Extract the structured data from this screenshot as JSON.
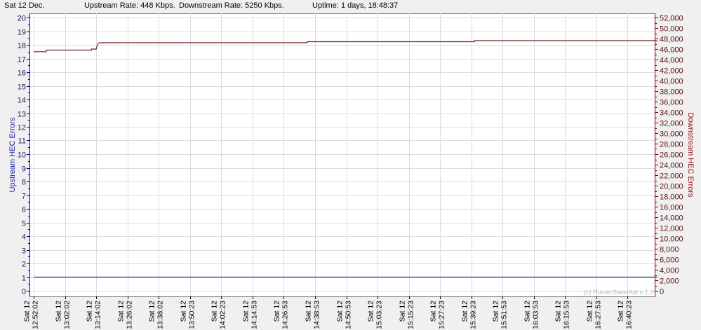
{
  "status": {
    "date": "Sat 12 Dec.",
    "upstream_rate": "Upstream Rate: 448 Kbps.",
    "downstream_rate": "Downstream Rate: 5250 Kbps.",
    "uptime": "Uptime: 1 days, 18:48:37"
  },
  "colors": {
    "upstream": "#1f3f8f",
    "downstream": "#7a1f1f"
  },
  "chart_data": {
    "type": "line",
    "title": "",
    "watermark": "(c) RouterStatsHub v 1.3",
    "ylabel": "Upstream HEC Errors",
    "y2label": "Downstream HEC Errors",
    "ylim": [
      0,
      20
    ],
    "y2lim": [
      0,
      52000
    ],
    "yticks": [
      "0",
      "1",
      "2",
      "3",
      "4",
      "5",
      "6",
      "7",
      "8",
      "9",
      "10",
      "11",
      "12",
      "13",
      "14",
      "15",
      "16",
      "17",
      "18",
      "19",
      "20"
    ],
    "y2ticks": [
      "0",
      "2,000",
      "4,000",
      "6,000",
      "8,000",
      "10,000",
      "12,000",
      "14,000",
      "16,000",
      "18,000",
      "20,000",
      "22,000",
      "24,000",
      "26,000",
      "28,000",
      "30,000",
      "32,000",
      "34,000",
      "36,000",
      "38,000",
      "40,000",
      "42,000",
      "44,000",
      "46,000",
      "48,000",
      "50,000",
      "52,000"
    ],
    "x_categories": [
      [
        "Sat 12",
        "12:52:02"
      ],
      [
        "Sat 12",
        "13:02:02"
      ],
      [
        "Sat 12",
        "13:14:02"
      ],
      [
        "Sat 12",
        "13:26:02"
      ],
      [
        "Sat 12",
        "13:38:02"
      ],
      [
        "Sat 12",
        "13:50:23"
      ],
      [
        "Sat 12",
        "14:02:23"
      ],
      [
        "Sat 12",
        "14:14:53"
      ],
      [
        "Sat 12",
        "14:26:53"
      ],
      [
        "Sat 12",
        "14:38:53"
      ],
      [
        "Sat 12",
        "14:50:53"
      ],
      [
        "Sat 12",
        "15:03:23"
      ],
      [
        "Sat 12",
        "15:15:23"
      ],
      [
        "Sat 12",
        "15:27:23"
      ],
      [
        "Sat 12",
        "15:39:23"
      ],
      [
        "Sat 12",
        "15:51:53"
      ],
      [
        "Sat 12",
        "16:03:53"
      ],
      [
        "Sat 12",
        "16:15:53"
      ],
      [
        "Sat 12",
        "16:27:53"
      ],
      [
        "Sat 12",
        "16:40:23"
      ]
    ],
    "series": [
      {
        "axis": "left",
        "points": [
          [
            0,
            1
          ],
          [
            19.95,
            1
          ]
        ]
      },
      {
        "axis": "right",
        "points": [
          [
            0,
            45500
          ],
          [
            0.4,
            45500
          ],
          [
            0.4,
            45800
          ],
          [
            1.85,
            45800
          ],
          [
            1.85,
            46000
          ],
          [
            2.0,
            46000
          ],
          [
            2.05,
            47000
          ],
          [
            2.1,
            47200
          ],
          [
            8.75,
            47200
          ],
          [
            8.75,
            47400
          ],
          [
            14.1,
            47400
          ],
          [
            14.1,
            47600
          ],
          [
            19.95,
            47600
          ]
        ]
      }
    ]
  }
}
